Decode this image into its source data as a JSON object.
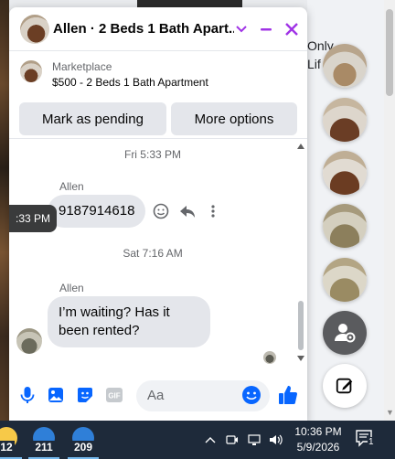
{
  "background": {
    "text_line1": "Only",
    "text_line2": "Lif"
  },
  "chat": {
    "title": "Allen · 2 Beds 1 Bath Apart...",
    "icons": [
      "chevron-down-icon",
      "minimize-icon",
      "close-icon"
    ],
    "colors": {
      "accent": "#a033e6",
      "blue": "#0866ff",
      "bubble": "#e4e6eb"
    },
    "marketplace": {
      "label": "Marketplace",
      "listing": "$500 - 2 Beds 1 Bath Apartment",
      "buttons": [
        "Mark as pending",
        "More options"
      ]
    },
    "messages": [
      {
        "timestamp": "Fri 5:33 PM",
        "sender": "Allen",
        "text": "9187914618"
      },
      {
        "timestamp": "Sat 7:16 AM",
        "sender": "Allen",
        "text_line1": "I’m waiting? Has it",
        "text_line2": "been rented?"
      }
    ],
    "tooltip": ":33 PM",
    "composer": {
      "placeholder": "Aa"
    }
  },
  "taskbar": {
    "apps": [
      {
        "count": "12",
        "color": "#f7c948"
      },
      {
        "count": "211",
        "color": "#2f7fd8"
      },
      {
        "count": "209",
        "color": "#2f7fd8"
      }
    ],
    "clock": {
      "time": "10:36 PM",
      "date": "5/9/2026"
    },
    "notifications": "1"
  }
}
